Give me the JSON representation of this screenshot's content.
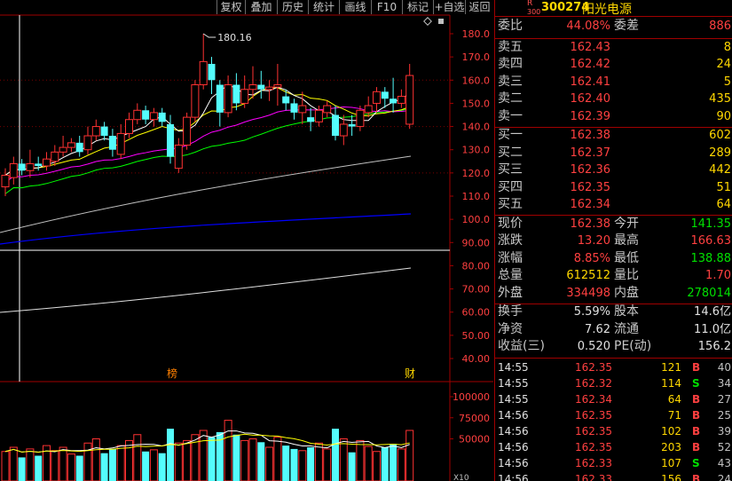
{
  "toolbar": {
    "buttons": [
      "复权",
      "叠加",
      "历史",
      "统计",
      "画线",
      "F10",
      "标记",
      "+自选",
      "返回"
    ]
  },
  "stock": {
    "badge_top": "R",
    "badge_bottom": "300",
    "code": "300274",
    "name": "阳光电源"
  },
  "order_ratio": {
    "label": "委比",
    "value": "44.08%",
    "label2": "委差",
    "value2": "886"
  },
  "asks": [
    {
      "label": "卖五",
      "price": "162.43",
      "vol": "8"
    },
    {
      "label": "卖四",
      "price": "162.42",
      "vol": "24"
    },
    {
      "label": "卖三",
      "price": "162.41",
      "vol": "5"
    },
    {
      "label": "卖二",
      "price": "162.40",
      "vol": "435"
    },
    {
      "label": "卖一",
      "price": "162.39",
      "vol": "90"
    }
  ],
  "bids": [
    {
      "label": "买一",
      "price": "162.38",
      "vol": "602"
    },
    {
      "label": "买二",
      "price": "162.37",
      "vol": "289"
    },
    {
      "label": "买三",
      "price": "162.36",
      "vol": "442"
    },
    {
      "label": "买四",
      "price": "162.35",
      "vol": "51"
    },
    {
      "label": "买五",
      "price": "162.34",
      "vol": "64"
    }
  ],
  "quote": [
    {
      "l1": "现价",
      "v1": "162.38",
      "c1": "red",
      "l2": "今开",
      "v2": "141.35",
      "c2": "green"
    },
    {
      "l1": "涨跌",
      "v1": "13.20",
      "c1": "red",
      "l2": "最高",
      "v2": "166.63",
      "c2": "red"
    },
    {
      "l1": "涨幅",
      "v1": "8.85%",
      "c1": "red",
      "l2": "最低",
      "v2": "138.88",
      "c2": "green"
    },
    {
      "l1": "总量",
      "v1": "612512",
      "c1": "yellow",
      "l2": "量比",
      "v2": "1.70",
      "c2": "red"
    },
    {
      "l1": "外盘",
      "v1": "334498",
      "c1": "red",
      "l2": "内盘",
      "v2": "278014",
      "c2": "green"
    }
  ],
  "fundamentals": [
    {
      "l1": "换手",
      "v1": "5.59%",
      "l2": "股本",
      "v2": "14.6亿"
    },
    {
      "l1": "净资",
      "v1": "7.62",
      "l2": "流通",
      "v2": "11.0亿"
    },
    {
      "l1": "收益(三)",
      "v1": "0.520",
      "l2": "PE(动)",
      "v2": "156.2"
    }
  ],
  "ticks": [
    {
      "time": "14:55",
      "price": "162.35",
      "vol": "121",
      "bs": "B",
      "n": "40"
    },
    {
      "time": "14:55",
      "price": "162.32",
      "vol": "114",
      "bs": "S",
      "n": "34"
    },
    {
      "time": "14:55",
      "price": "162.34",
      "vol": "64",
      "bs": "B",
      "n": "27"
    },
    {
      "time": "14:56",
      "price": "162.35",
      "vol": "71",
      "bs": "B",
      "n": "25"
    },
    {
      "time": "14:56",
      "price": "162.35",
      "vol": "102",
      "bs": "B",
      "n": "39"
    },
    {
      "time": "14:56",
      "price": "162.35",
      "vol": "203",
      "bs": "B",
      "n": "52"
    },
    {
      "time": "14:56",
      "price": "162.33",
      "vol": "107",
      "bs": "S",
      "n": "43"
    },
    {
      "time": "14:56",
      "price": "162.33",
      "vol": "156",
      "bs": "B",
      "n": "24"
    }
  ],
  "chart": {
    "price_ticks": [
      "180.0",
      "170.0",
      "160.0",
      "150.0",
      "140.0",
      "130.0",
      "120.0",
      "110.0",
      "100.0",
      "90.00",
      "80.00",
      "70.00",
      "60.00",
      "50.00",
      "40.00"
    ],
    "vol_ticks": [
      "100000",
      "75000",
      "50000"
    ],
    "vol_unit": "X10",
    "high_label": "180.16",
    "marker1": "榜",
    "marker2": "财"
  },
  "colors": {
    "up": "#ff3232",
    "down": "#54fcfc",
    "ma5": "#ffffff",
    "ma10": "#ffff00",
    "ma20": "#ff00ff",
    "ma30": "#00ff00",
    "ma60": "#c0c0c0",
    "ma120": "#0000ff"
  },
  "chart_data": {
    "type": "candlestick",
    "ylim": [
      40,
      185
    ],
    "high_marker": 180.16,
    "candles": [
      {
        "o": 114,
        "c": 119,
        "h": 122,
        "l": 110
      },
      {
        "o": 118,
        "c": 124,
        "h": 127,
        "l": 115
      },
      {
        "o": 124,
        "c": 121,
        "h": 126,
        "l": 119
      },
      {
        "o": 121,
        "c": 124,
        "h": 130,
        "l": 118
      },
      {
        "o": 124,
        "c": 123,
        "h": 127,
        "l": 121
      },
      {
        "o": 123,
        "c": 126,
        "h": 129,
        "l": 121
      },
      {
        "o": 125,
        "c": 129,
        "h": 132,
        "l": 123
      },
      {
        "o": 129,
        "c": 131,
        "h": 136,
        "l": 127
      },
      {
        "o": 131,
        "c": 133,
        "h": 135,
        "l": 129
      },
      {
        "o": 133,
        "c": 129,
        "h": 136,
        "l": 127
      },
      {
        "o": 130,
        "c": 136,
        "h": 140,
        "l": 128
      },
      {
        "o": 136,
        "c": 140,
        "h": 143,
        "l": 134
      },
      {
        "o": 140,
        "c": 136,
        "h": 142,
        "l": 134
      },
      {
        "o": 136,
        "c": 130,
        "h": 139,
        "l": 127
      },
      {
        "o": 128,
        "c": 137,
        "h": 141,
        "l": 126
      },
      {
        "o": 137,
        "c": 143,
        "h": 146,
        "l": 135
      },
      {
        "o": 143,
        "c": 147,
        "h": 150,
        "l": 141
      },
      {
        "o": 147,
        "c": 143,
        "h": 149,
        "l": 141
      },
      {
        "o": 143,
        "c": 146,
        "h": 148,
        "l": 140
      },
      {
        "o": 146,
        "c": 142,
        "h": 148,
        "l": 140
      },
      {
        "o": 141,
        "c": 127,
        "h": 145,
        "l": 124
      },
      {
        "o": 122,
        "c": 132,
        "h": 135,
        "l": 120
      },
      {
        "o": 132,
        "c": 144,
        "h": 146,
        "l": 130
      },
      {
        "o": 144,
        "c": 158,
        "h": 160,
        "l": 142
      },
      {
        "o": 158,
        "c": 168,
        "h": 180,
        "l": 156
      },
      {
        "o": 167,
        "c": 160,
        "h": 170,
        "l": 154
      },
      {
        "o": 158,
        "c": 146,
        "h": 160,
        "l": 140
      },
      {
        "o": 146,
        "c": 158,
        "h": 162,
        "l": 144
      },
      {
        "o": 158,
        "c": 150,
        "h": 163,
        "l": 147
      },
      {
        "o": 150,
        "c": 156,
        "h": 162,
        "l": 148
      },
      {
        "o": 156,
        "c": 158,
        "h": 166,
        "l": 152
      },
      {
        "o": 158,
        "c": 156,
        "h": 164,
        "l": 152
      },
      {
        "o": 156,
        "c": 157,
        "h": 160,
        "l": 151
      },
      {
        "o": 157,
        "c": 158,
        "h": 167,
        "l": 149
      },
      {
        "o": 153,
        "c": 150,
        "h": 156,
        "l": 147
      },
      {
        "o": 150,
        "c": 146,
        "h": 152,
        "l": 143
      },
      {
        "o": 146,
        "c": 149,
        "h": 155,
        "l": 141
      },
      {
        "o": 144,
        "c": 142,
        "h": 148,
        "l": 138
      },
      {
        "o": 142,
        "c": 147,
        "h": 149,
        "l": 140
      },
      {
        "o": 146,
        "c": 149,
        "h": 151,
        "l": 144
      },
      {
        "o": 145,
        "c": 136,
        "h": 149,
        "l": 134
      },
      {
        "o": 136,
        "c": 141,
        "h": 145,
        "l": 132
      },
      {
        "o": 141,
        "c": 140,
        "h": 145,
        "l": 136
      },
      {
        "o": 140,
        "c": 147,
        "h": 149,
        "l": 138
      },
      {
        "o": 146,
        "c": 149,
        "h": 153,
        "l": 144
      },
      {
        "o": 150,
        "c": 155,
        "h": 157,
        "l": 146
      },
      {
        "o": 155,
        "c": 152,
        "h": 157,
        "l": 148
      },
      {
        "o": 152,
        "c": 150,
        "h": 161,
        "l": 146
      },
      {
        "o": 150,
        "c": 153,
        "h": 156,
        "l": 148
      },
      {
        "o": 141,
        "c": 162,
        "h": 167,
        "l": 139
      }
    ],
    "volumes": [
      35,
      40,
      28,
      38,
      30,
      42,
      36,
      40,
      32,
      30,
      45,
      50,
      33,
      38,
      42,
      48,
      55,
      35,
      37,
      33,
      62,
      45,
      48,
      55,
      60,
      52,
      58,
      72,
      55,
      48,
      50,
      46,
      40,
      52,
      42,
      38,
      36,
      40,
      45,
      38,
      62,
      50,
      34,
      48,
      41,
      35,
      40,
      44,
      38,
      60
    ]
  }
}
